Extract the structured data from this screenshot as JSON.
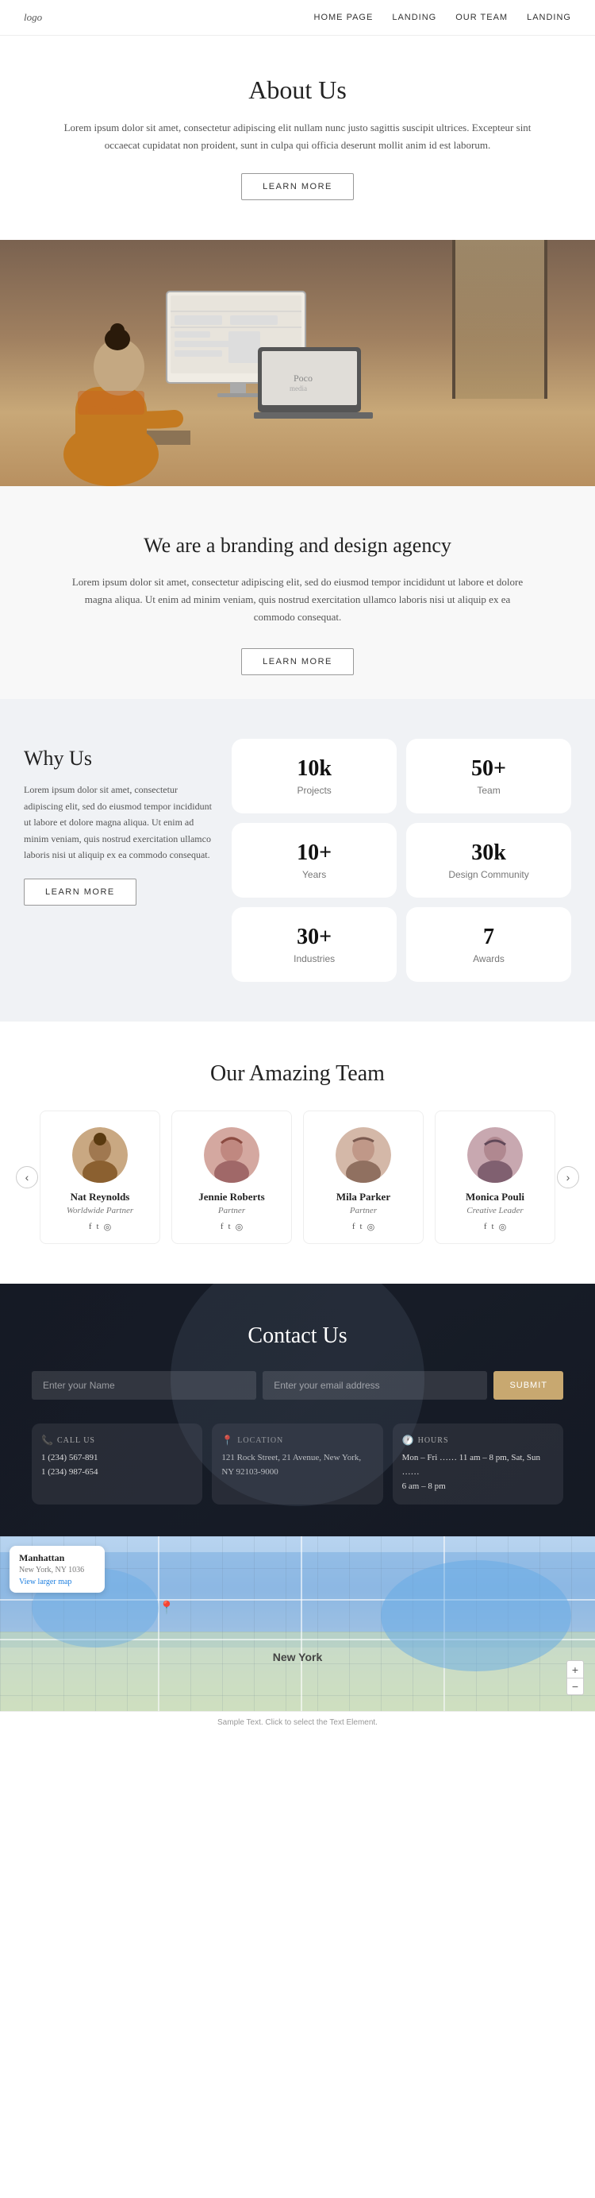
{
  "nav": {
    "logo": "logo",
    "links": [
      "HOME PAGE",
      "LANDING",
      "OUR TEAM",
      "LANDING"
    ]
  },
  "about": {
    "title": "About Us",
    "description": "Lorem ipsum dolor sit amet, consectetur adipiscing elit nullam nunc justo sagittis suscipit ultrices. Excepteur sint occaecat cupidatat non proident, sunt in culpa qui officia deserunt mollit anim id est laborum.",
    "cta": "LEARN MORE"
  },
  "branding": {
    "title": "We are a branding and design agency",
    "description": "Lorem ipsum dolor sit amet, consectetur adipiscing elit, sed do eiusmod tempor incididunt ut labore et dolore magna aliqua. Ut enim ad minim veniam, quis nostrud exercitation ullamco laboris nisi ut aliquip ex ea commodo consequat.",
    "cta": "LEARN MORE"
  },
  "why": {
    "title": "Why Us",
    "description": "Lorem ipsum dolor sit amet, consectetur adipiscing elit, sed do eiusmod tempor incididunt ut labore et dolore magna aliqua. Ut enim ad minim veniam, quis nostrud exercitation ullamco laboris nisi ut aliquip ex ea commodo consequat.",
    "cta": "LEARN MORE",
    "stats": [
      {
        "number": "10k",
        "label": "Projects"
      },
      {
        "number": "50+",
        "label": "Team"
      },
      {
        "number": "10+",
        "label": "Years"
      },
      {
        "number": "30k",
        "label": "Design Community"
      },
      {
        "number": "30+",
        "label": "Industries"
      },
      {
        "number": "7",
        "label": "Awards"
      }
    ]
  },
  "team": {
    "title": "Our Amazing Team",
    "members": [
      {
        "name": "Nat Reynolds",
        "title": "Worldwide Partner"
      },
      {
        "name": "Jennie Roberts",
        "title": "Partner"
      },
      {
        "name": "Mila Parker",
        "title": "Partner"
      },
      {
        "name": "Monica Pouli",
        "title": "Creative Leader"
      }
    ],
    "prev_icon": "‹",
    "next_icon": "›"
  },
  "contact": {
    "title": "Contact Us",
    "name_placeholder": "Enter your Name",
    "email_placeholder": "Enter your email address",
    "submit_label": "SUBMIT",
    "call_label": "CALL US",
    "call_phone1": "1 (234) 567-891",
    "call_phone2": "1 (234) 987-654",
    "location_label": "LOCATION",
    "location_address": "121 Rock Street, 21 Avenue, New York, NY 92103-9000",
    "hours_label": "HOURS",
    "hours_text": "Mon – Fri …… 11 am – 8 pm, Sat, Sun ……\n6 am – 8 pm"
  },
  "map": {
    "city": "New York",
    "overlay_title": "Manhattan",
    "overlay_sub": "New York, NY 1036",
    "overlay_link": "View larger map",
    "zoom_in": "+",
    "zoom_out": "−"
  },
  "footer": {
    "note": "Sample Text. Click to select the Text Element."
  },
  "icons": {
    "phone": "📞",
    "location": "📍",
    "hours": "🕐",
    "facebook": "f",
    "twitter": "t",
    "instagram": "o",
    "left_arrow": "‹",
    "right_arrow": "›",
    "plus": "+",
    "minus": "−"
  }
}
